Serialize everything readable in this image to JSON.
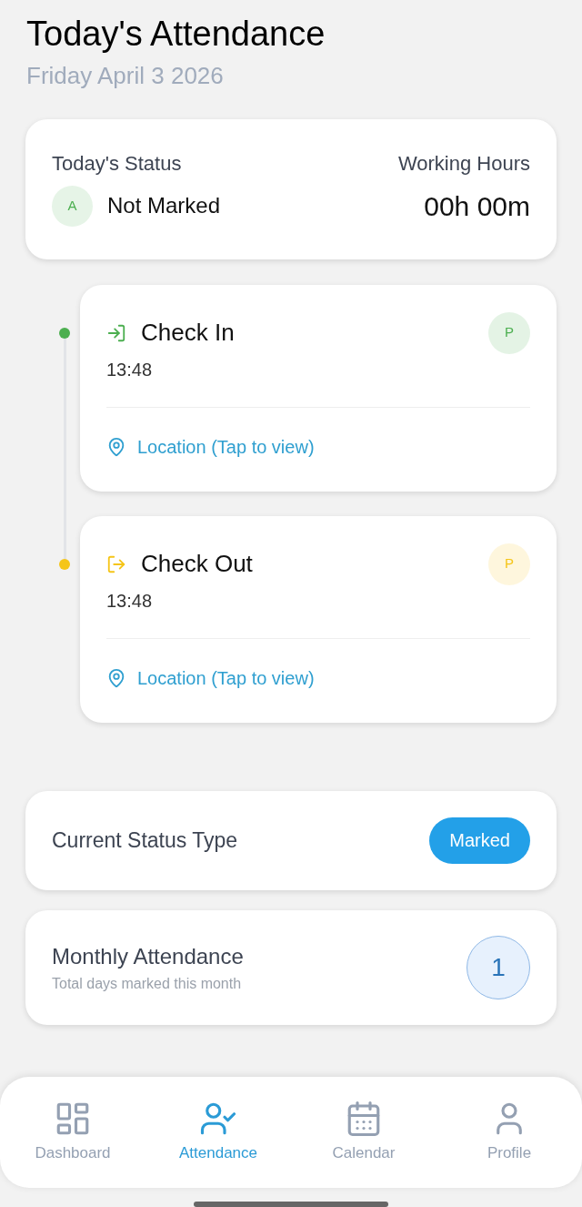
{
  "header": {
    "subtitle": "Friday April 3 2026",
    "page_title": "Today's Attendance"
  },
  "status_card": {
    "status_label": "Today's Status",
    "badge": "A",
    "status": "Not Marked",
    "hours_label": "Working Hours",
    "hours": "00h 00m"
  },
  "events": [
    {
      "kind": "check_in",
      "title": "Check In",
      "time": "13:48",
      "badge": "P",
      "color": "#4caf50",
      "location": "Location (Tap to view)"
    },
    {
      "kind": "check_out",
      "title": "Check Out",
      "time": "13:48",
      "badge": "P",
      "color": "#f5c518",
      "location": "Location (Tap to view)"
    }
  ],
  "status_type": {
    "label": "Current Status Type",
    "value": "Marked"
  },
  "monthly": {
    "title": "Monthly Attendance",
    "subtitle": "Total days marked this month",
    "count": "1"
  },
  "nav": [
    {
      "kind": "dashboard",
      "label": "Dashboard",
      "selected": false
    },
    {
      "kind": "attendance",
      "label": "Attendance",
      "selected": true
    },
    {
      "kind": "calendar",
      "label": "Calendar",
      "selected": false
    },
    {
      "kind": "profile",
      "label": "Profile",
      "selected": false
    }
  ]
}
